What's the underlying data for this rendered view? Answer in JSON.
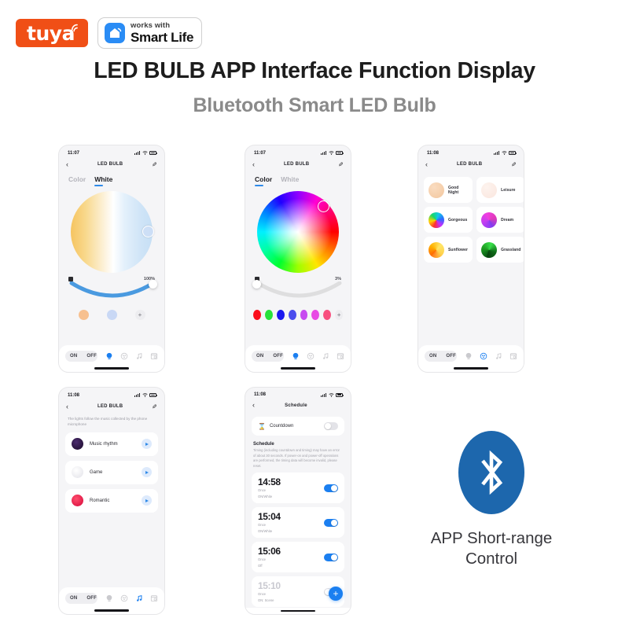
{
  "header": {
    "tuya_logo_text": "tuya",
    "tuya_icon": "wifi-signal-icon",
    "smartlife_works_with": "works with",
    "smartlife_name": "Smart Life",
    "smartlife_icon": "smart-home-icon",
    "title": "LED BULB APP Interface Function Display",
    "subtitle": "Bluetooth Smart LED Bulb"
  },
  "colors": {
    "tuya_orange": "#f04f16",
    "smartlife_blue": "#2a8cf5",
    "accent_blue": "#1b7ff0",
    "bluetooth_blue": "#1d67ad",
    "phone_bg": "#f5f5f7"
  },
  "phone1": {
    "status_time": "11:07",
    "nav_title": "LED BULB",
    "back_icon": "chevron-left-icon",
    "edit_icon": "pencil-edit-icon",
    "tab_color": "Color",
    "tab_white": "White",
    "active_tab": "White",
    "brightness_icon": "brightness-icon",
    "brightness_value": "100%",
    "swatches": [
      "#f7c08f",
      "#c9d8f5"
    ],
    "add_swatch": "+",
    "on_label": "ON",
    "off_label": "OFF",
    "toolbar_icons": [
      "bulb-icon",
      "palette-scene-icon",
      "music-note-icon",
      "schedule-timer-icon"
    ],
    "active_toolbar_icon": "bulb-icon"
  },
  "phone2": {
    "status_time": "11:07",
    "nav_title": "LED BULB",
    "back_icon": "chevron-left-icon",
    "edit_icon": "pencil-edit-icon",
    "tab_color": "Color",
    "tab_white": "White",
    "active_tab": "Color",
    "brightness_icon": "brightness-icon",
    "brightness_value": "3%",
    "swatches": [
      "#fb0d1b",
      "#28e23b",
      "#1a18ef",
      "#4b4ded",
      "#c74bf0",
      "#e84ae4",
      "#f8507f"
    ],
    "add_swatch": "+",
    "on_label": "ON",
    "off_label": "OFF",
    "toolbar_icons": [
      "bulb-icon",
      "palette-scene-icon",
      "music-note-icon",
      "schedule-timer-icon"
    ],
    "active_toolbar_icon": "bulb-icon"
  },
  "phone3": {
    "status_time": "11:08",
    "nav_title": "LED BULB",
    "back_icon": "chevron-left-icon",
    "edit_icon": "pencil-edit-icon",
    "scenes": [
      {
        "label": "Good Night",
        "color": "radial-gradient(circle at 35% 30%, #fadcc0, #f2c79e)"
      },
      {
        "label": "Leisure",
        "color": "radial-gradient(circle at 35% 30%, #fdf3ee, #fae6de)"
      },
      {
        "label": "Gorgeous",
        "color": "conic-gradient(from 200deg, #ff2d2d, #ffd500, #14d86a, #12c8e8, #2b6bff, #c52dff, #ff2d2d)"
      },
      {
        "label": "Dream",
        "color": "conic-gradient(from 160deg, #8b3bf5, #c33df0, #f03de0, #e03ab8, #7b3df2)"
      },
      {
        "label": "Sunflower",
        "color": "conic-gradient(from 220deg, #ff6a00, #ffb300, #ffe566, #ffd24d, #ff7a1a)"
      },
      {
        "label": "Grassland",
        "color": "conic-gradient(from 200deg, #0a5c15, #1f9e23, #39e04a, #0f6b18, #08400f)"
      }
    ],
    "on_label": "ON",
    "off_label": "OFF",
    "toolbar_icons": [
      "bulb-icon",
      "palette-scene-icon",
      "music-note-icon",
      "schedule-timer-icon"
    ],
    "active_toolbar_icon": "palette-scene-icon"
  },
  "phone4": {
    "status_time": "11:08",
    "nav_title": "LED BULB",
    "back_icon": "chevron-left-icon",
    "edit_icon": "pencil-edit-icon",
    "description": "The lights follow the music collected by the phone microphone",
    "modes": [
      {
        "label": "Music rhythm",
        "icon": "vinyl-record-icon",
        "color": "radial-gradient(circle at 40% 35%, #4b2b6e, #1a0b28)"
      },
      {
        "label": "Game",
        "icon": "gamepad-icon",
        "color": "radial-gradient(circle at 40% 35%, #ffffff, #e2e2e8)"
      },
      {
        "label": "Romantic",
        "icon": "heart-icon",
        "color": "radial-gradient(circle at 40% 35%, #ff4d6d, #d6093a)"
      }
    ],
    "play_icon": "play-icon",
    "on_label": "ON",
    "off_label": "OFF",
    "toolbar_icons": [
      "bulb-icon",
      "palette-scene-icon",
      "music-note-icon",
      "schedule-timer-icon"
    ],
    "active_toolbar_icon": "music-note-icon"
  },
  "phone5": {
    "status_time": "11:08",
    "nav_title": "Schedule",
    "back_icon": "chevron-left-icon",
    "countdown_label": "Countdown",
    "countdown_icon": "hourglass-icon",
    "countdown_on": false,
    "schedule_heading": "Schedule",
    "schedule_note": "Timing (including countdown and timing) may have an error of about 30 seconds. If power-on and power-off operations are performed, the timing data will become invalid, please reset.",
    "items": [
      {
        "time": "14:58",
        "repeat": "Once",
        "action": "ON/White",
        "enabled": true,
        "dim": false
      },
      {
        "time": "15:04",
        "repeat": "Once",
        "action": "ON/White",
        "enabled": true,
        "dim": false
      },
      {
        "time": "15:06",
        "repeat": "Once",
        "action": "Off",
        "enabled": true,
        "dim": false
      },
      {
        "time": "15:10",
        "repeat": "Once",
        "action": "ON: Scene",
        "enabled": false,
        "dim": true
      }
    ],
    "add_button": "+",
    "add_icon": "plus-icon"
  },
  "bluetooth": {
    "icon": "bluetooth-icon",
    "caption_line1": "APP Short-range",
    "caption_line2": "Control"
  }
}
